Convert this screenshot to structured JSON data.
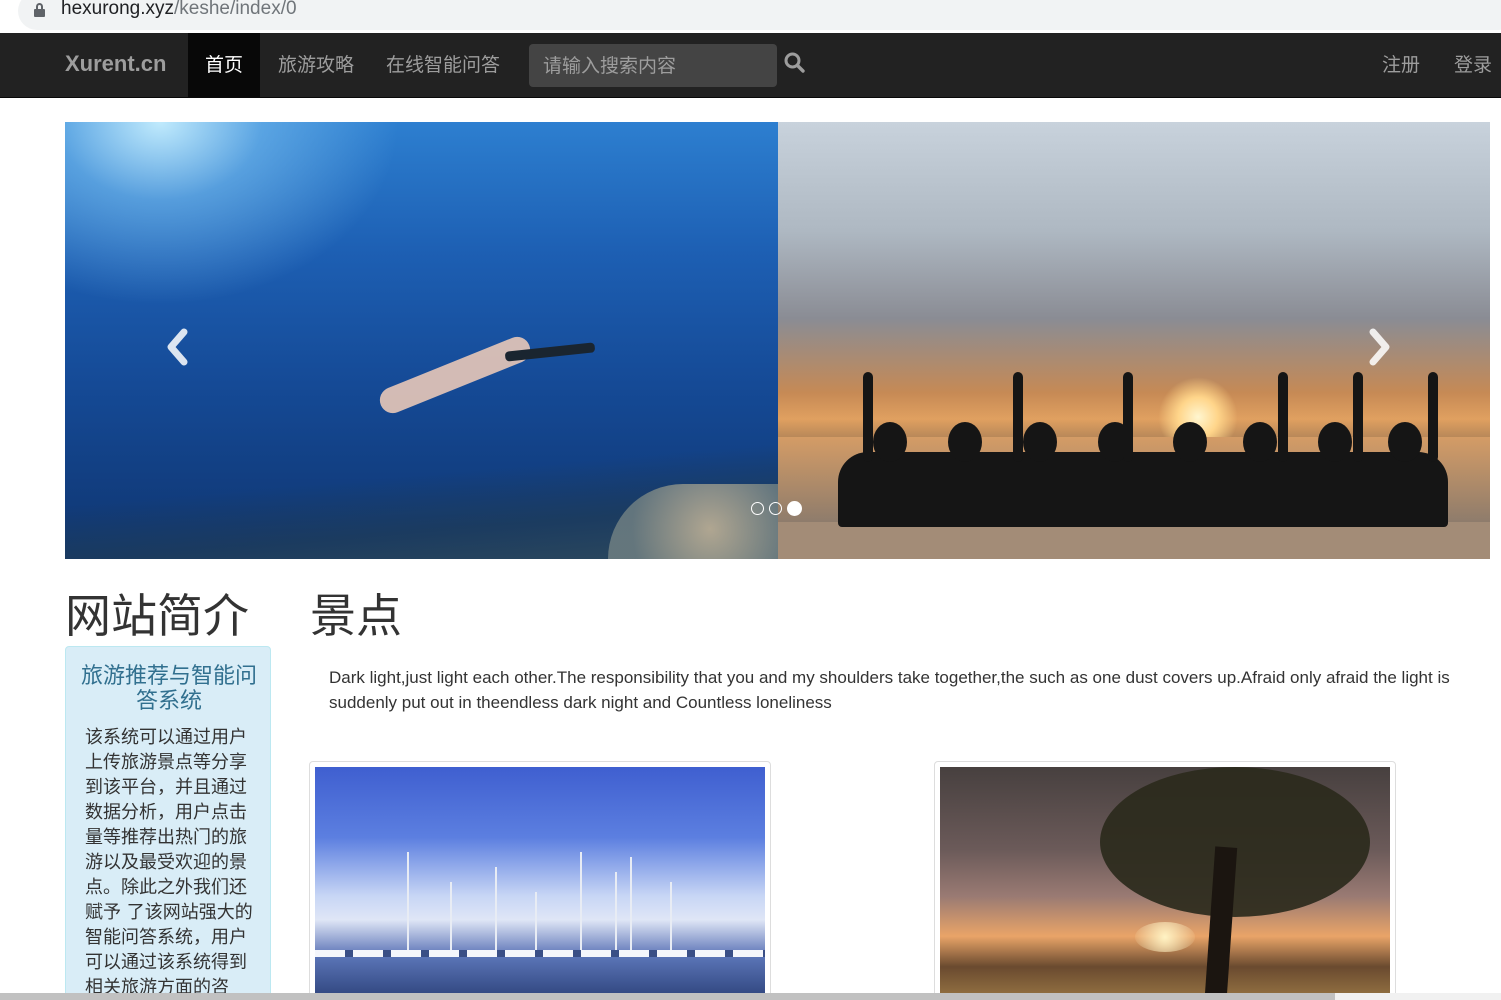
{
  "browser": {
    "url_domain": "hexurong.xyz",
    "url_path": "/keshe/index/0"
  },
  "navbar": {
    "brand": "Xurent.cn",
    "items": [
      {
        "label": "首页",
        "active": true
      },
      {
        "label": "旅游攻略",
        "active": false
      },
      {
        "label": "在线智能问答",
        "active": false
      }
    ],
    "search_placeholder": "请输入搜索内容",
    "register_label": "注册",
    "login_label": "登录"
  },
  "carousel": {
    "slide_count": 3,
    "active_index": 2
  },
  "sidebar": {
    "title": "网站简介",
    "box_heading": "旅游推荐与智能问答系统",
    "box_text": "该系统可以通过用户上传旅游景点等分享到该平台，并且通过数据分析，用户点击量等推荐出热门的旅游以及最受欢迎的景点。除此之外我们还赋予 了该网站强大的智能问答系统，用户可以通过该系统得到相关旅游方面的咨"
  },
  "main": {
    "title": "景点",
    "description": "Dark light,just light each other.The responsibility that you and my shoulders take together,the such as one dust covers up.Afraid only afraid the light is suddenly put out in theendless dark night and Countless loneliness"
  }
}
